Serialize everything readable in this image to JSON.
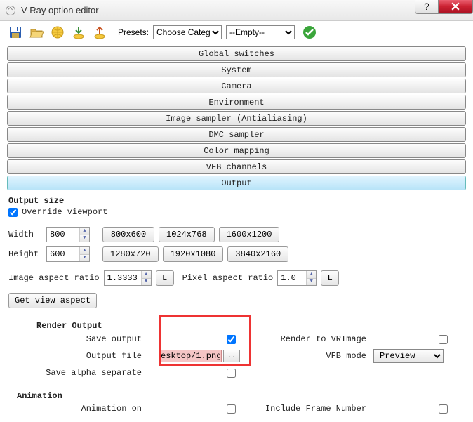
{
  "window": {
    "title": "V-Ray option editor"
  },
  "toolbar": {
    "presets_label": "Presets:",
    "category_value": "Choose Catego",
    "empty_value": "--Empty--"
  },
  "sections": [
    "Global switches",
    "System",
    "Camera",
    "Environment",
    "Image sampler (Antialiasing)",
    "DMC sampler",
    "Color mapping",
    "VFB channels",
    "Output"
  ],
  "output": {
    "size_title": "Output size",
    "override_label": "Override viewport",
    "override_checked": true,
    "width_label": "Width",
    "width_value": "800",
    "height_label": "Height",
    "height_value": "600",
    "presets_row1": [
      "800x600",
      "1024x768",
      "1600x1200"
    ],
    "presets_row2": [
      "1280x720",
      "1920x1080",
      "3840x2160"
    ],
    "iar_label": "Image aspect ratio",
    "iar_value": "1.33333",
    "lock_label": "L",
    "par_label": "Pixel aspect ratio",
    "par_value": "1.0",
    "get_view_aspect": "Get view aspect"
  },
  "render_output": {
    "title": "Render Output",
    "save_output_label": "Save output",
    "save_output_checked": true,
    "output_file_label": "Output file",
    "output_file_value": "esktop/1.png",
    "browse_label": "..",
    "save_alpha_label": "Save alpha separate",
    "save_alpha_checked": false,
    "render_vrimage_label": "Render to VRImage",
    "render_vrimage_checked": false,
    "vfb_mode_label": "VFB mode",
    "vfb_mode_value": "Preview"
  },
  "animation": {
    "title": "Animation",
    "animation_on_label": "Animation on",
    "animation_on_checked": false,
    "include_frame_label": "Include Frame Number",
    "include_frame_checked": false
  }
}
